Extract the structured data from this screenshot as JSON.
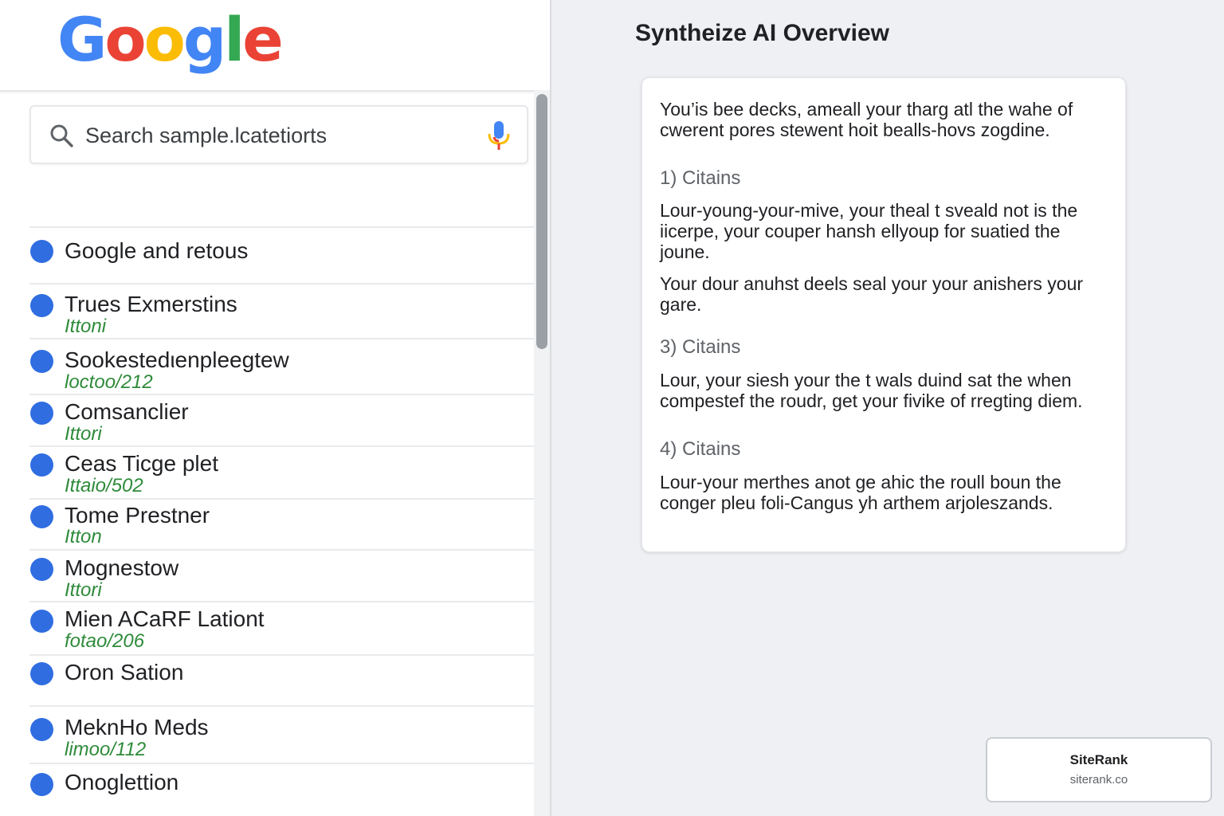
{
  "header": {
    "logo_letters": [
      {
        "char": "G",
        "color": "#4285F4"
      },
      {
        "char": "o",
        "color": "#EA4335"
      },
      {
        "char": "o",
        "color": "#FBBC05"
      },
      {
        "char": "g",
        "color": "#4285F4"
      },
      {
        "char": "l",
        "color": "#34A853"
      },
      {
        "char": "e",
        "color": "#EA4335"
      }
    ]
  },
  "search": {
    "placeholder": "Search sample.lcatetiorts",
    "icon": "search-icon",
    "mic_icon": "mic-icon"
  },
  "results": [
    {
      "title": "Google and retous",
      "sub": ""
    },
    {
      "title": "Trues Exmerstins",
      "sub": "Ittoni"
    },
    {
      "title": "Sookestedιenpleegtew",
      "sub": "loctoo/212"
    },
    {
      "title": "Comsanclier",
      "sub": "Ittori"
    },
    {
      "title": "Ceas Ticge plet",
      "sub": "Ittaio/502"
    },
    {
      "title": "Tome Prestner",
      "sub": "Itton"
    },
    {
      "title": "Mognestow",
      "sub": "Ittori"
    },
    {
      "title": "Mien ACaRF Lationt",
      "sub": "fotao/206"
    },
    {
      "title": "Oron Sation",
      "sub": ""
    },
    {
      "title": "MeknHo Meds",
      "sub": "limoo/112"
    },
    {
      "title": "Onoglettion",
      "sub": ""
    }
  ],
  "overview": {
    "title": "Syntheize AI Overview",
    "intro": "You’is bee decks, ameall your tharg atl the wahe of cwerent pores stewent hoit bealls-hovs zogdine.",
    "sections": [
      {
        "heading": "1) Citains",
        "paragraphs": [
          "Lour-young-your-mive, your theal t sveald not is the iicerpe, your couper hansh ellyoup for suatied the joune.",
          "Your dour anuhst deels seal your your anishers your gare."
        ]
      },
      {
        "heading": "3) Citains",
        "paragraphs": [
          "Lour, your siesh your the t wals duind sat the when compestef the roudr, get your fivike of rregting diem."
        ]
      },
      {
        "heading": "4) Citains",
        "paragraphs": [
          "Lour-your merthes anot ge ahic the roull boun the conger pleu foli-Cangus yh arthem arjoleszands."
        ]
      }
    ]
  },
  "badge": {
    "name": "SiteRank",
    "url": "siterank.co"
  },
  "colors": {
    "result_dot": "#2f6de1",
    "result_sub": "#2e8b3a",
    "mic_blue": "#4285F4",
    "mic_red": "#EA4335"
  }
}
